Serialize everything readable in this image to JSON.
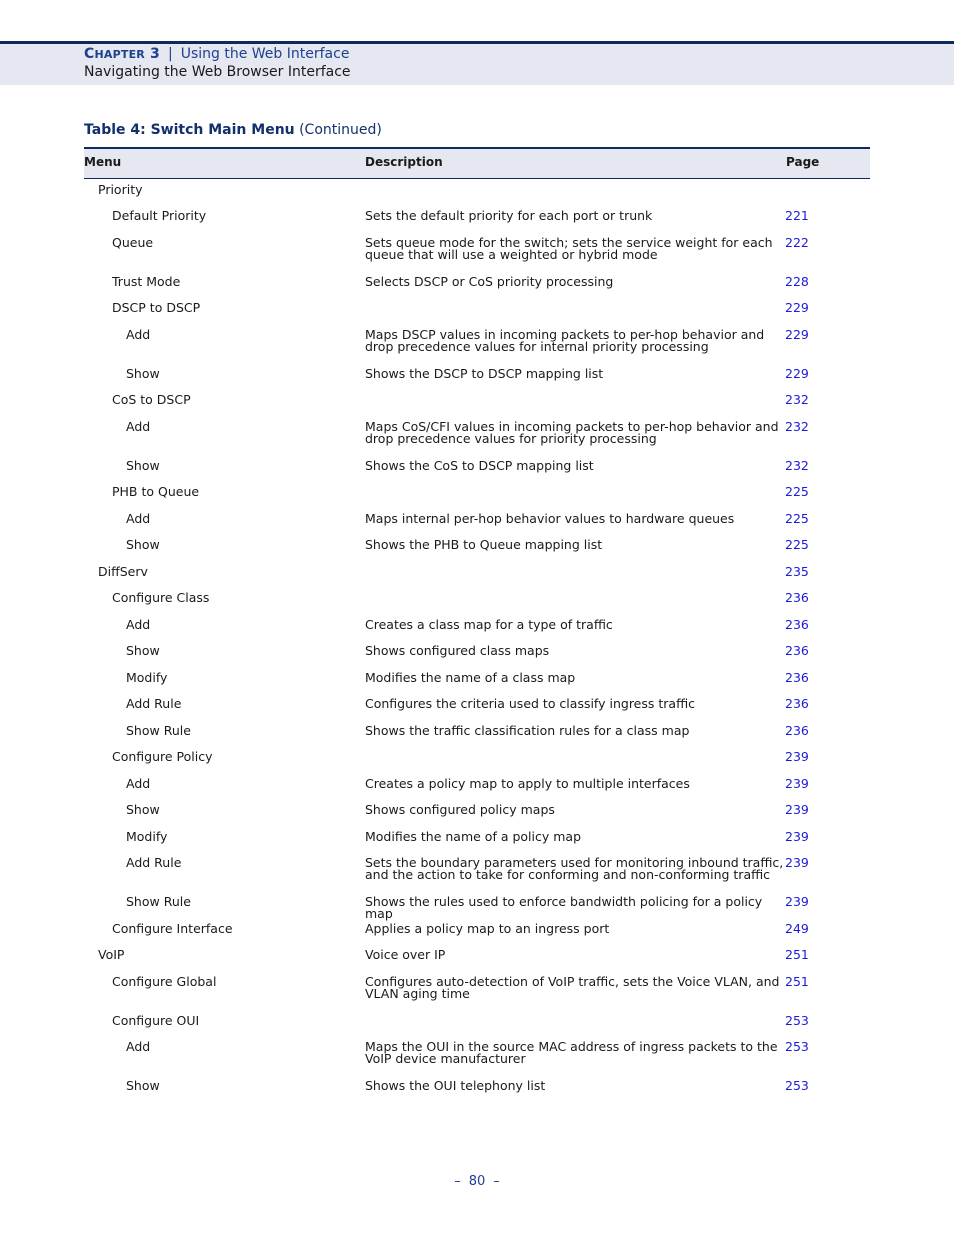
{
  "header": {
    "chapter_label_first": "C",
    "chapter_label_rest": "HAPTER",
    "chapter_number": "3",
    "separator": "|",
    "chapter_title": "Using the Web Interface",
    "section_title": "Navigating the Web Browser Interface"
  },
  "table": {
    "caption_bold": "Table 4: Switch Main Menu",
    "caption_suffix": "(Continued)",
    "columns": {
      "menu": "Menu",
      "description": "Description",
      "page": "Page"
    },
    "rows": [
      {
        "level": 1,
        "menu": "Priority",
        "description": "",
        "page": ""
      },
      {
        "level": 2,
        "menu": "Default Priority",
        "description": "Sets the default priority for each port or trunk",
        "page": "221"
      },
      {
        "level": 2,
        "menu": "Queue",
        "description": "Sets queue mode for the switch; sets the service weight for each queue that will use a weighted or hybrid mode",
        "page": "222"
      },
      {
        "level": 2,
        "menu": "Trust Mode",
        "description": "Selects DSCP or CoS priority processing",
        "page": "228"
      },
      {
        "level": 2,
        "menu": "DSCP to DSCP",
        "description": "",
        "page": "229"
      },
      {
        "level": 3,
        "menu": "Add",
        "description": "Maps DSCP values in incoming packets to per-hop behavior and drop precedence values for internal priority processing",
        "page": "229"
      },
      {
        "level": 3,
        "menu": "Show",
        "description": "Shows the DSCP to DSCP mapping list",
        "page": "229"
      },
      {
        "level": 2,
        "menu": "CoS to DSCP",
        "description": "",
        "page": "232"
      },
      {
        "level": 3,
        "menu": "Add",
        "description": "Maps CoS/CFI values in incoming packets to per-hop behavior and drop precedence values for priority processing",
        "page": "232"
      },
      {
        "level": 3,
        "menu": "Show",
        "description": "Shows the CoS to DSCP mapping list",
        "page": "232"
      },
      {
        "level": 2,
        "menu": "PHB to Queue",
        "description": "",
        "page": "225"
      },
      {
        "level": 3,
        "menu": "Add",
        "description": "Maps internal per-hop behavior values to hardware queues",
        "page": "225"
      },
      {
        "level": 3,
        "menu": "Show",
        "description": "Shows the PHB to Queue mapping list",
        "page": "225"
      },
      {
        "level": 1,
        "menu": "DiffServ",
        "description": "",
        "page": "235"
      },
      {
        "level": 2,
        "menu": "Configure Class",
        "description": "",
        "page": "236"
      },
      {
        "level": 3,
        "menu": "Add",
        "description": "Creates a class map for a type of traffic",
        "page": "236"
      },
      {
        "level": 3,
        "menu": "Show",
        "description": "Shows configured class maps",
        "page": "236"
      },
      {
        "level": 3,
        "menu": "Modify",
        "description": "Modifies the name of a class map",
        "page": "236"
      },
      {
        "level": 3,
        "menu": "Add Rule",
        "description": "Configures the criteria used to classify ingress traffic",
        "page": "236"
      },
      {
        "level": 3,
        "menu": "Show Rule",
        "description": "Shows the traffic classification rules for a class map",
        "page": "236"
      },
      {
        "level": 2,
        "menu": "Configure Policy",
        "description": "",
        "page": "239"
      },
      {
        "level": 3,
        "menu": "Add",
        "description": "Creates a policy map to apply to multiple interfaces",
        "page": "239"
      },
      {
        "level": 3,
        "menu": "Show",
        "description": "Shows configured policy maps",
        "page": "239"
      },
      {
        "level": 3,
        "menu": "Modify",
        "description": "Modifies the name of a policy map",
        "page": "239"
      },
      {
        "level": 3,
        "menu": "Add Rule",
        "description": "Sets the boundary parameters used for monitoring inbound traffic, and the action to take for conforming and non-conforming traffic",
        "page": "239"
      },
      {
        "level": 3,
        "menu": "Show Rule",
        "description": "Shows the rules used to enforce bandwidth policing for a policy map",
        "page": "239"
      },
      {
        "level": 2,
        "menu": "Configure Interface",
        "description": "Applies a policy map to an ingress port",
        "page": "249"
      },
      {
        "level": 1,
        "menu": "VoIP",
        "description": "Voice over IP",
        "page": "251"
      },
      {
        "level": 2,
        "menu": "Configure Global",
        "description": "Configures auto-detection of VoIP traffic, sets the Voice VLAN, and VLAN aging time",
        "page": "251"
      },
      {
        "level": 2,
        "menu": "Configure OUI",
        "description": "",
        "page": "253"
      },
      {
        "level": 3,
        "menu": "Add",
        "description": "Maps the OUI in the source MAC address of ingress packets to the VoIP device manufacturer",
        "page": "253"
      },
      {
        "level": 3,
        "menu": "Show",
        "description": "Shows the OUI telephony list",
        "page": "253"
      }
    ]
  },
  "footer": {
    "dash": "–",
    "page_number": "80"
  }
}
